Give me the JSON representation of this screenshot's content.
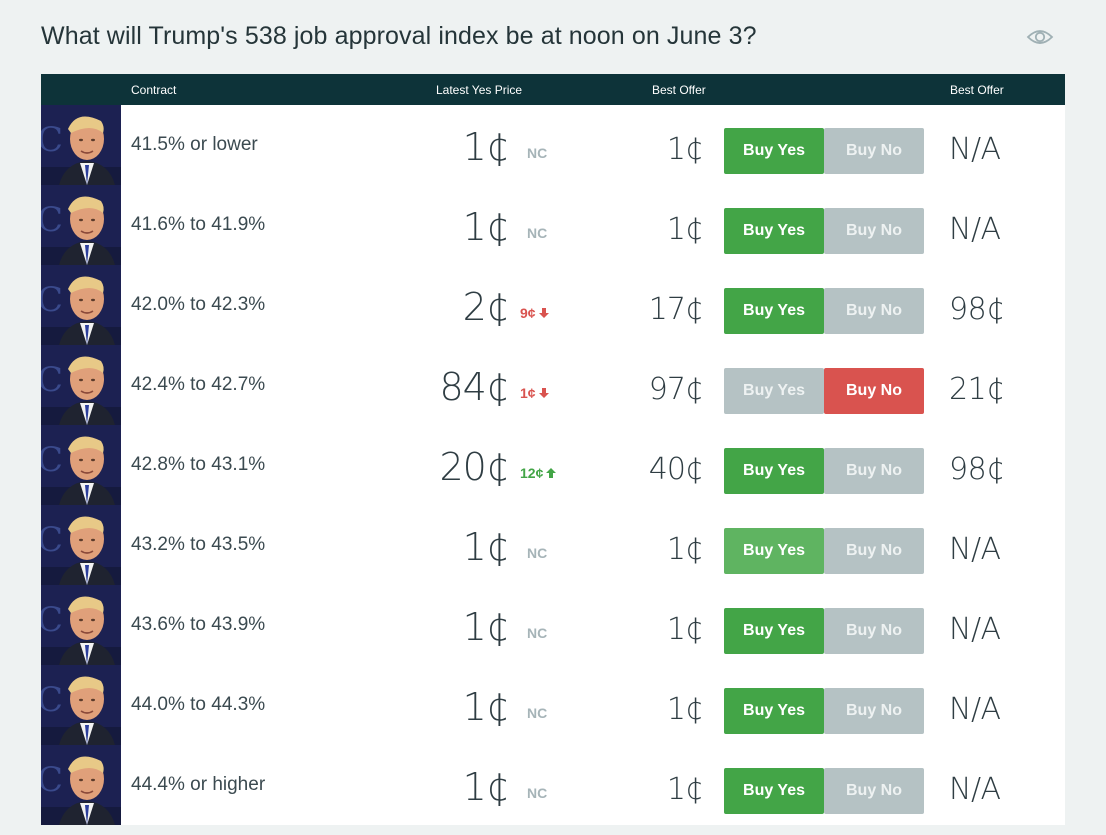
{
  "page": {
    "title": "What will Trump's 538 job approval index be at noon on June 3?"
  },
  "table": {
    "headers": {
      "contract": "Contract",
      "latest_yes_price": "Latest Yes Price",
      "best_offer_yes": "Best Offer",
      "best_offer_no": "Best Offer"
    },
    "rows": [
      {
        "contract": "41.5% or lower",
        "latest": "1¢",
        "change": "NC",
        "change_dir": "nc",
        "best_yes": "1¢",
        "buy_yes": "Buy Yes",
        "buy_no": "Buy No",
        "best_no": "N/A",
        "yes_state": "active",
        "no_state": "muted"
      },
      {
        "contract": "41.6% to 41.9%",
        "latest": "1¢",
        "change": "NC",
        "change_dir": "nc",
        "best_yes": "1¢",
        "buy_yes": "Buy Yes",
        "buy_no": "Buy No",
        "best_no": "N/A",
        "yes_state": "active",
        "no_state": "muted"
      },
      {
        "contract": "42.0% to 42.3%",
        "latest": "2¢",
        "change": "9¢",
        "change_dir": "down",
        "best_yes": "17¢",
        "buy_yes": "Buy Yes",
        "buy_no": "Buy No",
        "best_no": "98¢",
        "yes_state": "active",
        "no_state": "muted"
      },
      {
        "contract": "42.4% to 42.7%",
        "latest": "84¢",
        "change": "1¢",
        "change_dir": "down",
        "best_yes": "97¢",
        "buy_yes": "Buy Yes",
        "buy_no": "Buy No",
        "best_no": "21¢",
        "yes_state": "muted",
        "no_state": "active"
      },
      {
        "contract": "42.8% to 43.1%",
        "latest": "20¢",
        "change": "12¢",
        "change_dir": "up",
        "best_yes": "40¢",
        "buy_yes": "Buy Yes",
        "buy_no": "Buy No",
        "best_no": "98¢",
        "yes_state": "active",
        "no_state": "muted"
      },
      {
        "contract": "43.2% to 43.5%",
        "latest": "1¢",
        "change": "NC",
        "change_dir": "nc",
        "best_yes": "1¢",
        "buy_yes": "Buy Yes",
        "buy_no": "Buy No",
        "best_no": "N/A",
        "yes_state": "hover",
        "no_state": "muted"
      },
      {
        "contract": "43.6% to 43.9%",
        "latest": "1¢",
        "change": "NC",
        "change_dir": "nc",
        "best_yes": "1¢",
        "buy_yes": "Buy Yes",
        "buy_no": "Buy No",
        "best_no": "N/A",
        "yes_state": "active",
        "no_state": "muted"
      },
      {
        "contract": "44.0% to 44.3%",
        "latest": "1¢",
        "change": "NC",
        "change_dir": "nc",
        "best_yes": "1¢",
        "buy_yes": "Buy Yes",
        "buy_no": "Buy No",
        "best_no": "N/A",
        "yes_state": "active",
        "no_state": "muted"
      },
      {
        "contract": "44.4% or higher",
        "latest": "1¢",
        "change": "NC",
        "change_dir": "nc",
        "best_yes": "1¢",
        "buy_yes": "Buy Yes",
        "buy_no": "Buy No",
        "best_no": "N/A",
        "yes_state": "active",
        "no_state": "muted"
      }
    ]
  },
  "icons": {
    "watch": "eye-icon",
    "down": "arrow-down-icon",
    "up": "arrow-up-icon"
  },
  "colors": {
    "header_bg": "#0d3339",
    "buy_yes": "#43a547",
    "buy_no_active": "#d9534f",
    "button_muted": "#b5c2c4",
    "change_down": "#d9534f",
    "change_up": "#43a547"
  }
}
